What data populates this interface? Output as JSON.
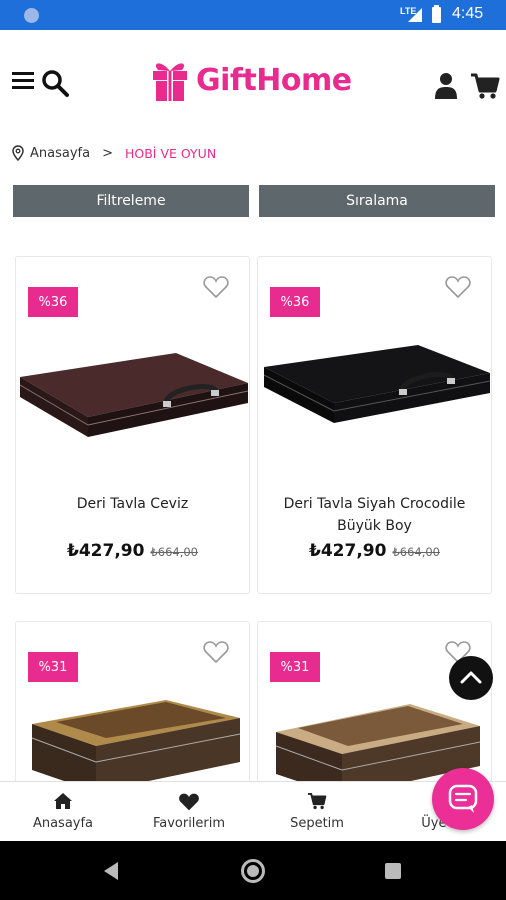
{
  "status_bar": {
    "network": "LTE",
    "time": "4:45"
  },
  "header": {
    "logo_text": "GiftHome"
  },
  "breadcrumb": {
    "home": "Anasayfa",
    "separator": ">",
    "current": "HOBİ VE OYUN"
  },
  "toolbar": {
    "filter_label": "Filtreleme",
    "sort_label": "Sıralama"
  },
  "products": [
    {
      "discount": "%36",
      "name": "Deri Tavla Ceviz",
      "price": "₺427,90",
      "old_price": "₺664,00",
      "color": "#4a2a2b"
    },
    {
      "discount": "%36",
      "name": "Deri Tavla Siyah Crocodile Büyük Boy",
      "price": "₺427,90",
      "old_price": "₺664,00",
      "color": "#141416"
    },
    {
      "discount": "%31",
      "color": "#6b4a2a"
    },
    {
      "discount": "%31",
      "color": "#7a5a3a"
    }
  ],
  "bottom_nav": [
    {
      "label": "Anasayfa",
      "icon": "home-icon"
    },
    {
      "label": "Favorilerim",
      "icon": "heart-icon"
    },
    {
      "label": "Sepetim",
      "icon": "cart-icon"
    },
    {
      "label": "Üye G",
      "icon": "user-icon"
    }
  ],
  "colors": {
    "brand": "#e82b8f",
    "status_bar": "#1e6fd9",
    "button_bg": "#5e676b"
  }
}
